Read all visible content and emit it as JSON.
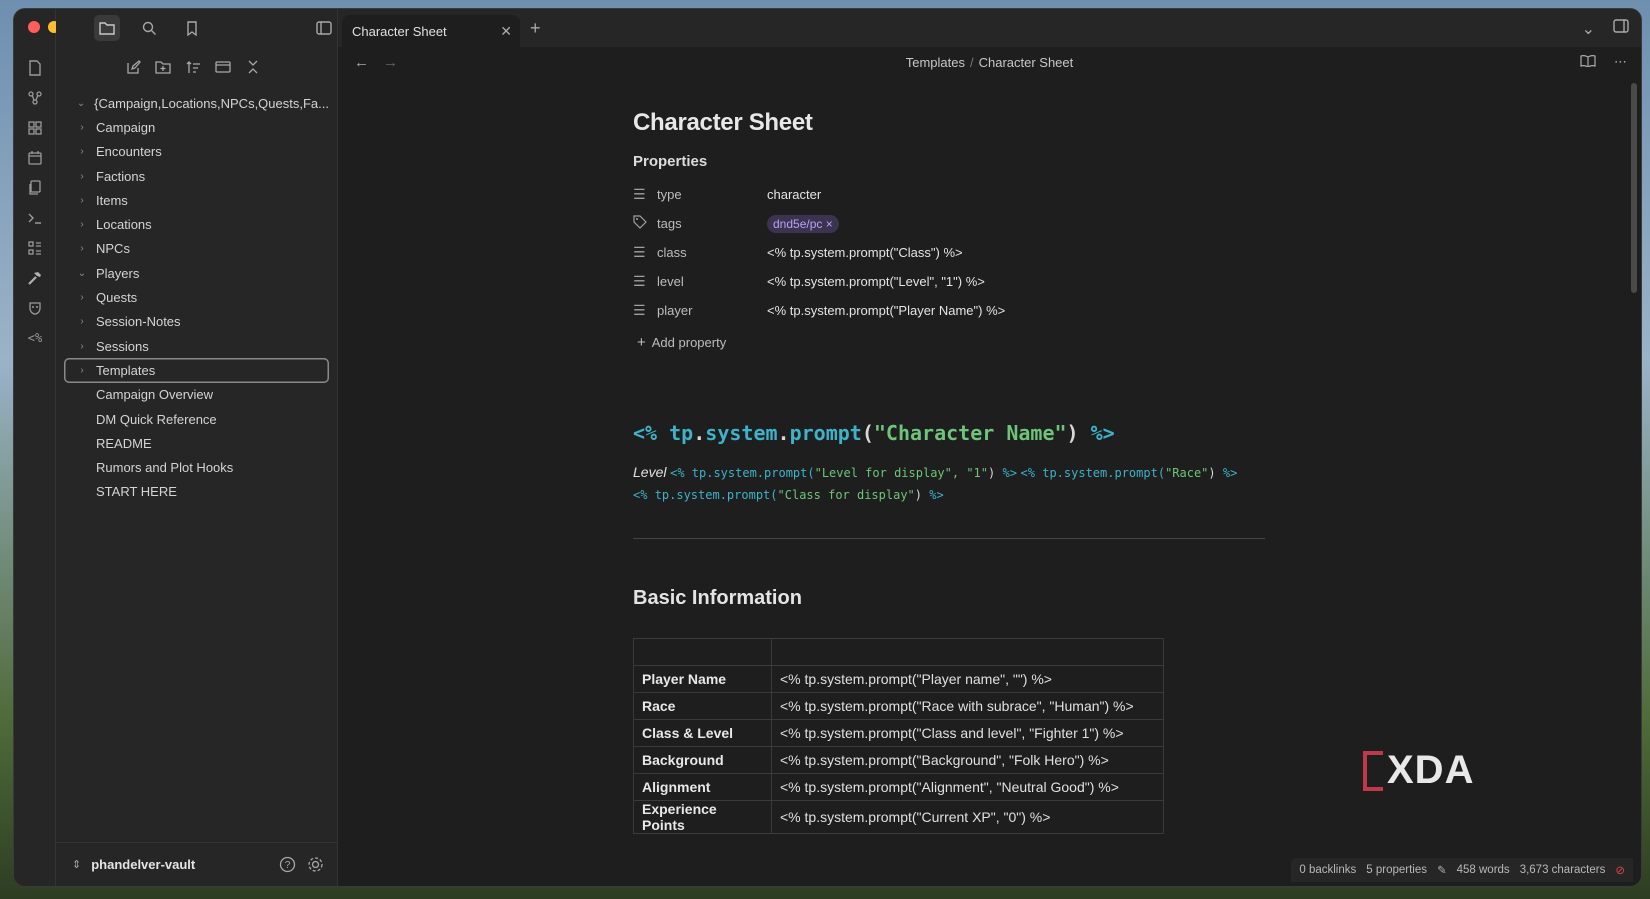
{
  "app": {
    "tab_title": "Character Sheet",
    "breadcrumb_parent": "Templates",
    "breadcrumb_sep": "/",
    "breadcrumb_current": "Character Sheet"
  },
  "ribbon": {
    "icons": [
      "file-icon",
      "graph-icon",
      "canvas-icon",
      "calendar-icon",
      "pages-icon",
      "terminal-icon",
      "outline-icon",
      "hammer-icon",
      "mask-icon",
      "template-icon"
    ]
  },
  "sidebar": {
    "root_folder": "{Campaign,Locations,NPCs,Quests,Fa...",
    "folders": [
      {
        "label": "Campaign",
        "open": false
      },
      {
        "label": "Encounters",
        "open": false
      },
      {
        "label": "Factions",
        "open": false
      },
      {
        "label": "Items",
        "open": false
      },
      {
        "label": "Locations",
        "open": false
      },
      {
        "label": "NPCs",
        "open": false
      },
      {
        "label": "Players",
        "open": true
      },
      {
        "label": "Quests",
        "open": false
      },
      {
        "label": "Session-Notes",
        "open": false
      },
      {
        "label": "Sessions",
        "open": false
      },
      {
        "label": "Templates",
        "open": false,
        "selected": true
      }
    ],
    "files": [
      "Campaign Overview",
      "DM Quick Reference",
      "README",
      "Rumors and Plot Hooks",
      "START HERE"
    ],
    "vault_name": "phandelver-vault"
  },
  "note": {
    "title": "Character Sheet",
    "properties_label": "Properties",
    "properties": [
      {
        "key": "type",
        "value": "character"
      },
      {
        "key": "tags",
        "value": "dnd5e/pc"
      },
      {
        "key": "class",
        "value": "<% tp.system.prompt(\"Class\") %>"
      },
      {
        "key": "level",
        "value": "<% tp.system.prompt(\"Level\", \"1\") %>"
      },
      {
        "key": "player",
        "value": "<% tp.system.prompt(\"Player Name\") %>"
      }
    ],
    "add_property": "Add property",
    "heading_code": {
      "open": "<%",
      "obj": "tp",
      "dot1": ".",
      "sys": "system",
      "dot2": ".",
      "fn": "prompt",
      "lp": "(",
      "arg": "\"Character Name\"",
      "rp": ")",
      "close": "%>"
    },
    "level_word": "Level",
    "level_code_1": "tp.system.prompt(",
    "level_code_1_args": "\"Level for display\", \"1\"",
    "level_code_2": "tp.system.prompt(",
    "level_code_2_args": "\"Race\"",
    "level_code_3": "tp.system.prompt(",
    "level_code_3_args": "\"Class for display\"",
    "basic_info_heading": "Basic Information",
    "table_rows": [
      {
        "key": "Player Name",
        "value": "<% tp.system.prompt(\"Player name\", \"\") %>"
      },
      {
        "key": "Race",
        "value": "<% tp.system.prompt(\"Race with subrace\", \"Human\") %>"
      },
      {
        "key": "Class & Level",
        "value": "<% tp.system.prompt(\"Class and level\", \"Fighter 1\") %>"
      },
      {
        "key": "Background",
        "value": "<% tp.system.prompt(\"Background\", \"Folk Hero\") %>"
      },
      {
        "key": "Alignment",
        "value": "<% tp.system.prompt(\"Alignment\", \"Neutral Good\") %>"
      },
      {
        "key": "Experience Points",
        "value": "<% tp.system.prompt(\"Current XP\", \"0\") %>"
      }
    ]
  },
  "status": {
    "backlinks": "0 backlinks",
    "properties": "5 properties",
    "words": "458 words",
    "characters": "3,673 characters"
  },
  "watermark": {
    "text": "XDA"
  },
  "colors": {
    "accent_cyan": "#3db2c9",
    "string_green": "#6dc47a",
    "tag_purple": "#b8a4f0",
    "sync_red": "#e0434b"
  }
}
